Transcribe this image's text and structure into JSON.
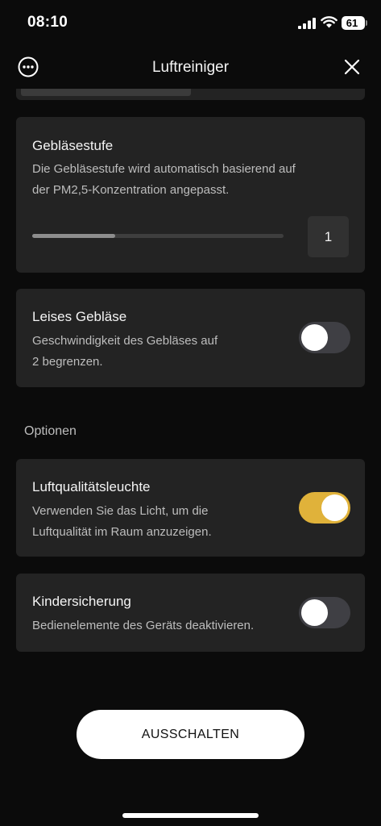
{
  "status_bar": {
    "time": "08:10",
    "battery": "61"
  },
  "nav": {
    "title": "Luftreiniger",
    "more_icon": "ellipsis-circle-icon",
    "close_icon": "close-icon"
  },
  "fan_speed": {
    "title": "Gebläsestufe",
    "desc_line1": "Die Gebläsestufe wird automatisch basierend auf",
    "desc_line2": "der PM2,5-Konzentration angepasst.",
    "value": "1",
    "slider_fraction": 0.33
  },
  "quiet_fan": {
    "title": "Leises Gebläse",
    "desc_line1": "Geschwindigkeit des Gebläses auf",
    "desc_line2": "2 begrenzen.",
    "enabled": false
  },
  "options_label": "Optionen",
  "air_quality_light": {
    "title": "Luftqualitätsleuchte",
    "desc_line1": "Verwenden Sie das Licht, um die",
    "desc_line2": "Luftqualität im Raum anzuzeigen.",
    "enabled": true
  },
  "child_lock": {
    "title": "Kindersicherung",
    "desc_line1": "Bedienelemente des Geräts deaktivieren.",
    "enabled": false
  },
  "power_off_button": {
    "label": "AUSSCHALTEN"
  },
  "colors": {
    "accent": "#e0b23a",
    "card": "#232323",
    "background": "#0b0b0b"
  }
}
